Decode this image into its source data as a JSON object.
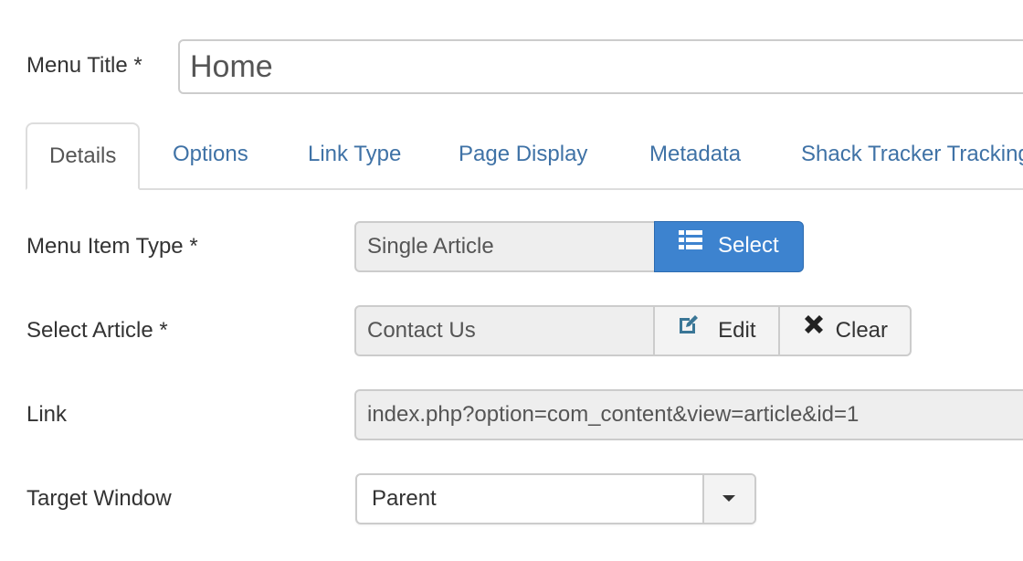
{
  "menu_title": {
    "label": "Menu Title *",
    "value": "Home"
  },
  "tabs": [
    {
      "label": "Details",
      "active": true
    },
    {
      "label": "Options",
      "active": false
    },
    {
      "label": "Link Type",
      "active": false
    },
    {
      "label": "Page Display",
      "active": false
    },
    {
      "label": "Metadata",
      "active": false
    },
    {
      "label": "Shack Tracker Tracking",
      "active": false
    }
  ],
  "fields": {
    "menu_item_type": {
      "label": "Menu Item Type *",
      "value": "Single Article",
      "button_label": "Select",
      "button_icon": "list-icon"
    },
    "select_article": {
      "label": "Select Article *",
      "value": "Contact Us",
      "edit_label": "Edit",
      "edit_icon": "edit-icon",
      "clear_label": "Clear",
      "clear_icon": "close-icon"
    },
    "link": {
      "label": "Link",
      "value": "index.php?option=com_content&view=article&id=1"
    },
    "target_window": {
      "label": "Target Window",
      "value": "Parent"
    }
  },
  "colors": {
    "accent": "#3d83cf",
    "tab_link": "#3f72a6",
    "edit_icon": "#3a7696"
  }
}
